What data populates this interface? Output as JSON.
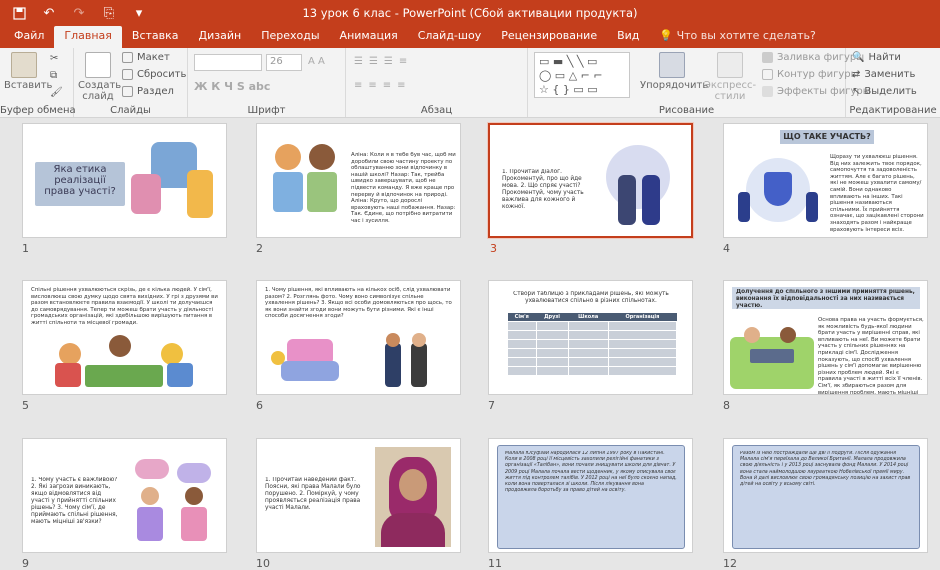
{
  "titlebar": {
    "title": "13 урок 6 клас - PowerPoint (Сбой активации продукта)",
    "qat_icons": [
      "save-icon",
      "undo-icon",
      "redo-icon",
      "present-icon",
      "customize-icon"
    ]
  },
  "tabs": [
    {
      "label": "Файл",
      "active": false
    },
    {
      "label": "Главная",
      "active": true
    },
    {
      "label": "Вставка",
      "active": false
    },
    {
      "label": "Дизайн",
      "active": false
    },
    {
      "label": "Переходы",
      "active": false
    },
    {
      "label": "Анимация",
      "active": false
    },
    {
      "label": "Слайд-шоу",
      "active": false
    },
    {
      "label": "Рецензирование",
      "active": false
    },
    {
      "label": "Вид",
      "active": false
    }
  ],
  "tell_me": "Что вы хотите сделать?",
  "ribbon": {
    "clipboard": {
      "label": "Буфер обмена",
      "paste": "Вставить"
    },
    "slides": {
      "label": "Слайды",
      "new_slide": "Создать слайд",
      "layout": "Макет",
      "reset": "Сбросить",
      "section": "Раздел"
    },
    "font": {
      "label": "Шрифт",
      "size": "26",
      "buttons": "Ж К Ч S abc"
    },
    "paragraph": {
      "label": "Абзац"
    },
    "drawing": {
      "label": "Рисование",
      "arrange": "Упорядочить",
      "styles": "Экспресс-стили",
      "fill": "Заливка фигуры",
      "outline": "Контур фигуры",
      "effects": "Эффекты фигуры"
    },
    "editing": {
      "label": "Редактирование",
      "find": "Найти",
      "replace": "Заменить",
      "select": "Выделить"
    }
  },
  "colors": {
    "accent": "#c43e1c",
    "ribbon": "#f3f3f3",
    "canvas": "#e6e6e6"
  },
  "slides": [
    {
      "number": "1",
      "title": "Яка етика реалізації права участі?"
    },
    {
      "number": "2",
      "text": "Аліна: Коли я в тебе був час, щоб ми доробили свою частину проекту по облаштуванню зони відпочинку в нашій школі? Назар: Так, трейба швидко завершувати, щоб не підвести команду. Я вже краще про перерву й відпочинок на природі. Аліна: Круто, що дорослі враховують наші побажання. Назар: Так. Єдине, що потрібно витратити час і зусилля."
    },
    {
      "number": "3",
      "text": "1. Прочитай діалог. Прокоментуй, про що йде мова. 2. Що спряє участі? Прокоментуй, чому участь важлива для кожного й кожної."
    },
    {
      "number": "4",
      "title": "ЩО ТАКЕ УЧАСТЬ?",
      "text": "Щоразу ти ухвалюєш рішення. Від них залежить твоє порядок, самопочуття та задоволеність життям. Але є багато рішень, які не можеш ухвалити самому/самій. Вони однаково впливають на інших. Такі рішення називаються спільними. Їх прийняття означає, що зацікавлені сторони знаходять разом і найкраще враховують інтереси всіх."
    },
    {
      "number": "5",
      "text": "Спільні рішення ухвалюються скрізь, де є кілька людей. У сім'ї, висловлюєш свою думку щодо свята вихідних. У грі з друзями ви разом встановлюєте правила взаємодії. У школі ти долучаєшся до самоврядування. Тепер ти можеш брати участь у діяльності громадських організацій, які здебільшою вирішують питання в житті спільноти та місцевої громади."
    },
    {
      "number": "6",
      "text": "1. Чому рішення, які впливають на кількох осіб, слід ухвалювати разом? 2. Розглянь фото. Чому воно символізує спільне ухвалення рішень? 3. Якщо всі особи домовляються про щось, то як вони знайти згоди вони можуть бути різними. Які є інші способи досягнення згоди?"
    },
    {
      "number": "7",
      "text": "Створи таблицю з прикладами рішень, які можуть ухвалюватися спільно в різних спільнотах.",
      "table_headers": [
        "Сім'я",
        "Друзі",
        "Школа",
        "Організація"
      ]
    },
    {
      "number": "8",
      "title": "Долучення до спільного з іншими прийняття рішень, виконання їх відповідальності за них називається участю.",
      "text": "Основа права на участь формується, як можливість будь-якої людини брати участь у вирішенні справ, які впливають на неї. Ви можете брати участь у спільних рішеннях на прикладі сім'ї. Дослідження показують, що спосіб ухвалення рішень у сім'ї допомагає вирішенню різних проблем людей. Які є правила участі в житті всіх її членів. Сім'ї, як збираються разом для вирішення проблем, мають міцніші зв'язки."
    },
    {
      "number": "9",
      "text": "1. Чому участь є важливою? 2. Які загрози виникають, якщо відмовлятися від участі у прийнятті спільних рішень? 3. Чому сім'ї, де приймають спільні рішення, мають міцніші зв'язки?"
    },
    {
      "number": "10",
      "text": "1. Прочитай наведений факт. Поясни, які права Малали було порушено. 2. Поміркуй, у чому проявляється реалізація права участі Малали."
    },
    {
      "number": "11",
      "text": "Малала Юсуфзай народилася 12 липня 1997 року в Пакистані. Коли в 2008 році її місцевість захопили релігійні фанатики з організації «Талібан», вони почали знищувати школи для дівчат. У 2009 році Малала почала вести щоденник, у якому описувала своє життя під контролем талібів. У 2012 році на неї було скоєно напад, коли вона поверталася зі школи. Після лікування вона продовжила боротьбу за право дітей на освіту."
    },
    {
      "number": "12",
      "text": "Разом із нею постраждали ще дві її подруги. Після одужання Малала сім'я переїхала до Великої Британії. Малала продовжила свою діяльність і у 2013 році заснувала фонд Малали. У 2014 році вона стала наймолодшою лауреаткою Нобелівської премії миру. Вона й далі висловлює свою громадянську позицію на захист прав дітей на освіту у всьому світі."
    }
  ]
}
